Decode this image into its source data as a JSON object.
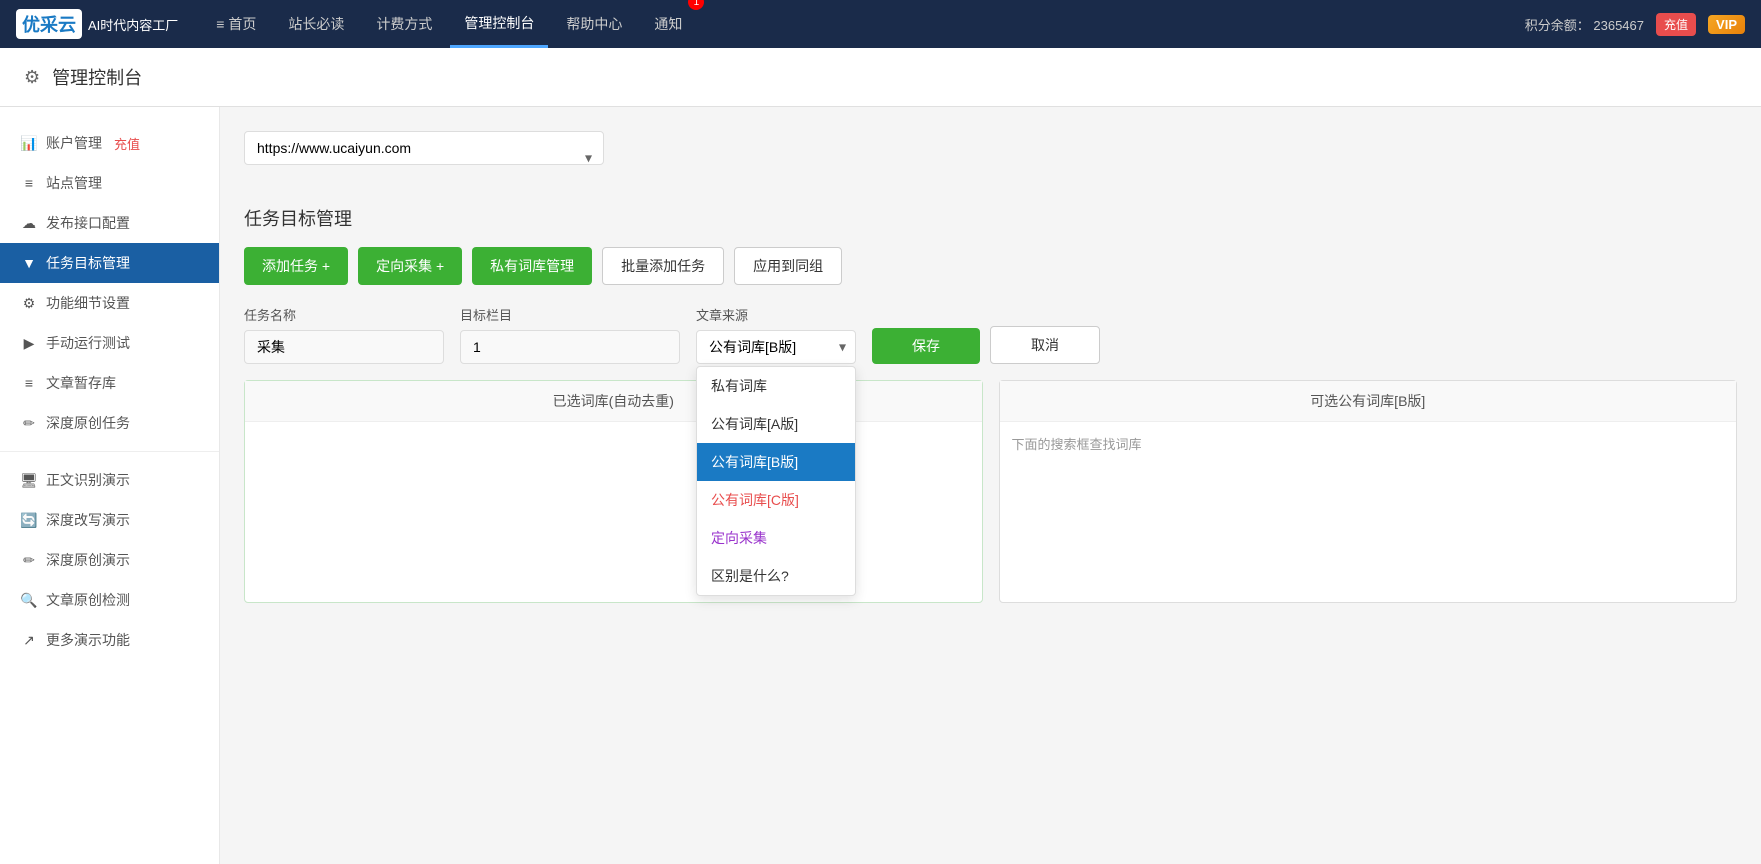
{
  "nav": {
    "logo_text": "AI时代内容工厂",
    "logo_short": "优采云",
    "items": [
      {
        "label": "≡ 首页",
        "key": "home",
        "active": false
      },
      {
        "label": "站长必读",
        "key": "must-read",
        "active": false
      },
      {
        "label": "计费方式",
        "key": "billing",
        "active": false
      },
      {
        "label": "管理控制台",
        "key": "dashboard",
        "active": true
      },
      {
        "label": "帮助中心",
        "key": "help",
        "active": false
      },
      {
        "label": "通知",
        "key": "notification",
        "active": false
      }
    ],
    "notification_count": "1",
    "points_label": "积分余额：",
    "points_value": "2365467",
    "recharge_label": "充值",
    "vip_label": "VIP"
  },
  "page_header": {
    "icon": "⚙",
    "title": "管理控制台"
  },
  "sidebar": {
    "items": [
      {
        "icon": "📊",
        "label": "账户管理",
        "recharge": "充值",
        "key": "account",
        "active": false
      },
      {
        "icon": "≡",
        "label": "站点管理",
        "key": "site",
        "active": false
      },
      {
        "icon": "☁",
        "label": "发布接口配置",
        "key": "publish",
        "active": false
      },
      {
        "icon": "▼",
        "label": "任务目标管理",
        "key": "task",
        "active": true
      },
      {
        "icon": "⚙",
        "label": "功能细节设置",
        "key": "settings",
        "active": false
      },
      {
        "icon": "▶",
        "label": "手动运行测试",
        "key": "test",
        "active": false
      },
      {
        "icon": "≡",
        "label": "文章暂存库",
        "key": "draft",
        "active": false
      },
      {
        "icon": "✏",
        "label": "深度原创任务",
        "key": "original",
        "active": false
      },
      {
        "icon": "🖥",
        "label": "正文识别演示",
        "key": "demo1",
        "active": false
      },
      {
        "icon": "🔄",
        "label": "深度改写演示",
        "key": "demo2",
        "active": false
      },
      {
        "icon": "✏",
        "label": "深度原创演示",
        "key": "demo3",
        "active": false
      },
      {
        "icon": "🔍",
        "label": "文章原创检测",
        "key": "demo4",
        "active": false
      },
      {
        "icon": "↗",
        "label": "更多演示功能",
        "key": "demo5",
        "active": false
      }
    ]
  },
  "content": {
    "site_url": "https://www.ucaiyun.com",
    "site_url_placeholder": "https://www.ucaiyun.com",
    "section_title": "任务目标管理",
    "buttons": {
      "add_task": "添加任务 +",
      "directed_collect": "定向采集 +",
      "private_lib": "私有词库管理",
      "batch_add": "批量添加任务",
      "apply_group": "应用到同组"
    },
    "form": {
      "task_name_label": "任务名称",
      "task_name_value": "采集",
      "target_column_label": "目标栏目",
      "target_column_value": "1",
      "source_label": "文章来源",
      "source_selected": "公有词库[B版]",
      "save_label": "保存",
      "cancel_label": "取消"
    },
    "dropdown_options": [
      {
        "label": "私有词库",
        "value": "private",
        "style": "normal"
      },
      {
        "label": "公有词库[A版]",
        "value": "public_a",
        "style": "normal"
      },
      {
        "label": "公有词库[B版]",
        "value": "public_b",
        "style": "selected"
      },
      {
        "label": "公有词库[C版]",
        "value": "public_c",
        "style": "c-version"
      },
      {
        "label": "定向采集",
        "value": "directed",
        "style": "directed"
      },
      {
        "label": "区别是什么?",
        "value": "difference",
        "style": "difference"
      }
    ],
    "left_panel_header": "已选词库(自动去重)",
    "right_panel_header": "可选公有词库[B版]",
    "right_panel_hint": "下面的搜索框查找词库"
  }
}
